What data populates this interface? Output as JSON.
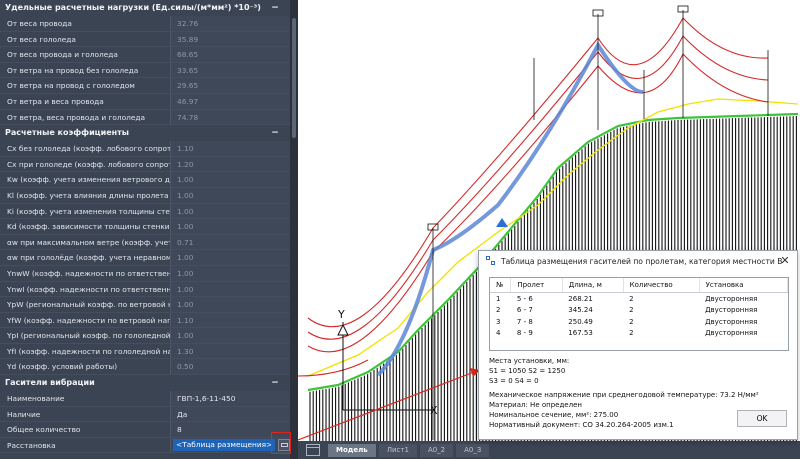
{
  "props": {
    "sections": [
      {
        "title": "Удельные расчетные нагрузки (Ед.силы/(м*мм²) *10⁻³)",
        "rows": [
          {
            "label": "От веса провода",
            "value": "32.76"
          },
          {
            "label": "От веса гололеда",
            "value": "35.89"
          },
          {
            "label": "От веса провода и гололеда",
            "value": "68.65"
          },
          {
            "label": "От ветра на провод без гололеда",
            "value": "33.65"
          },
          {
            "label": "От ветра на провод с гололедом",
            "value": "29.65"
          },
          {
            "label": "От ветра и веса провода",
            "value": "46.97"
          },
          {
            "label": "От ветра, веса провода и гололеда",
            "value": "74.78"
          }
        ]
      },
      {
        "title": "Расчетные коэффициенты",
        "rows": [
          {
            "label": "Cx без гололеда (коэфф. лобового сопрот...",
            "value": "1.10"
          },
          {
            "label": "Cx при гололеде (коэфф. лобового сопрот...",
            "value": "1.20"
          },
          {
            "label": "Kw (коэфф. учета изменения ветрового д...",
            "value": "1.00"
          },
          {
            "label": "Kl (коэфф. учета влияния длины пролета ...",
            "value": "1.00"
          },
          {
            "label": "Ki (коэфф. учета изменения толщины стенк...",
            "value": "1.00"
          },
          {
            "label": "Kd (коэфф. зависимости толщины стенки г...",
            "value": "1.00"
          },
          {
            "label": "αw при максимальном ветре (коэфф. учет...",
            "value": "0.71"
          },
          {
            "label": "αw при гололёде (коэфф. учета неравном...",
            "value": "1.00"
          },
          {
            "label": "YnwW (коэфф. надежности по ответствен...",
            "value": "1.00"
          },
          {
            "label": "YnwI (коэфф. надежности по ответственн...",
            "value": "1.00"
          },
          {
            "label": "YpW (региональный коэфф. по ветровой н...",
            "value": "1.00"
          },
          {
            "label": "YfW (коэфф. надежности по ветровой наг...",
            "value": "1.10"
          },
          {
            "label": "YpI (региональный коэфф. по гололедной ...",
            "value": "1.00"
          },
          {
            "label": "YfI (коэфф. надежности по гололедной на...",
            "value": "1.30"
          },
          {
            "label": "Yd (коэфф. условий работы)",
            "value": "0.50"
          }
        ]
      },
      {
        "title": "Гасители вибрации",
        "rows": [
          {
            "label": "Наименование",
            "value": "ГВП-1,6-11-450"
          },
          {
            "label": "Наличие",
            "value": "Да"
          },
          {
            "label": "Общее количество",
            "value": "8"
          },
          {
            "label": "Расстановка",
            "value": "<Таблица размещения>"
          }
        ]
      }
    ],
    "collapse_glyph": "−"
  },
  "tabs": [
    "Модель",
    "Лист1",
    "А0_2",
    "А0_3"
  ],
  "drawing": {
    "axis_y": "Y",
    "axis_x": "X"
  },
  "dialog": {
    "title": "Таблица размещения гасителей по пролетам, категория местности В",
    "close": "✕",
    "columns": [
      "№",
      "Пролет",
      "Длина, м",
      "Количество",
      "Установка"
    ],
    "rows": [
      [
        "1",
        "5 - 6",
        "268.21",
        "2",
        "Двусторонняя"
      ],
      [
        "2",
        "6 - 7",
        "345.24",
        "2",
        "Двусторонняя"
      ],
      [
        "3",
        "7 - 8",
        "250.49",
        "2",
        "Двусторонняя"
      ],
      [
        "4",
        "8 - 9",
        "167.53",
        "2",
        "Двусторонняя"
      ]
    ],
    "places_title": "Места установки, мм:",
    "places_line1": "S1 = 1050  S2 = 1250",
    "places_line2": "S3 = 0  S4 = 0",
    "stress": "Механическое напряжение при среднегодовой температуре: 73.2 Н/мм²",
    "material": "Материал: Не определен",
    "section": "Номинальное сечение, мм²: 275.00",
    "normative": "Нормативный документ: СО 34.20.264-2005 изм.1",
    "ok": "OK"
  }
}
